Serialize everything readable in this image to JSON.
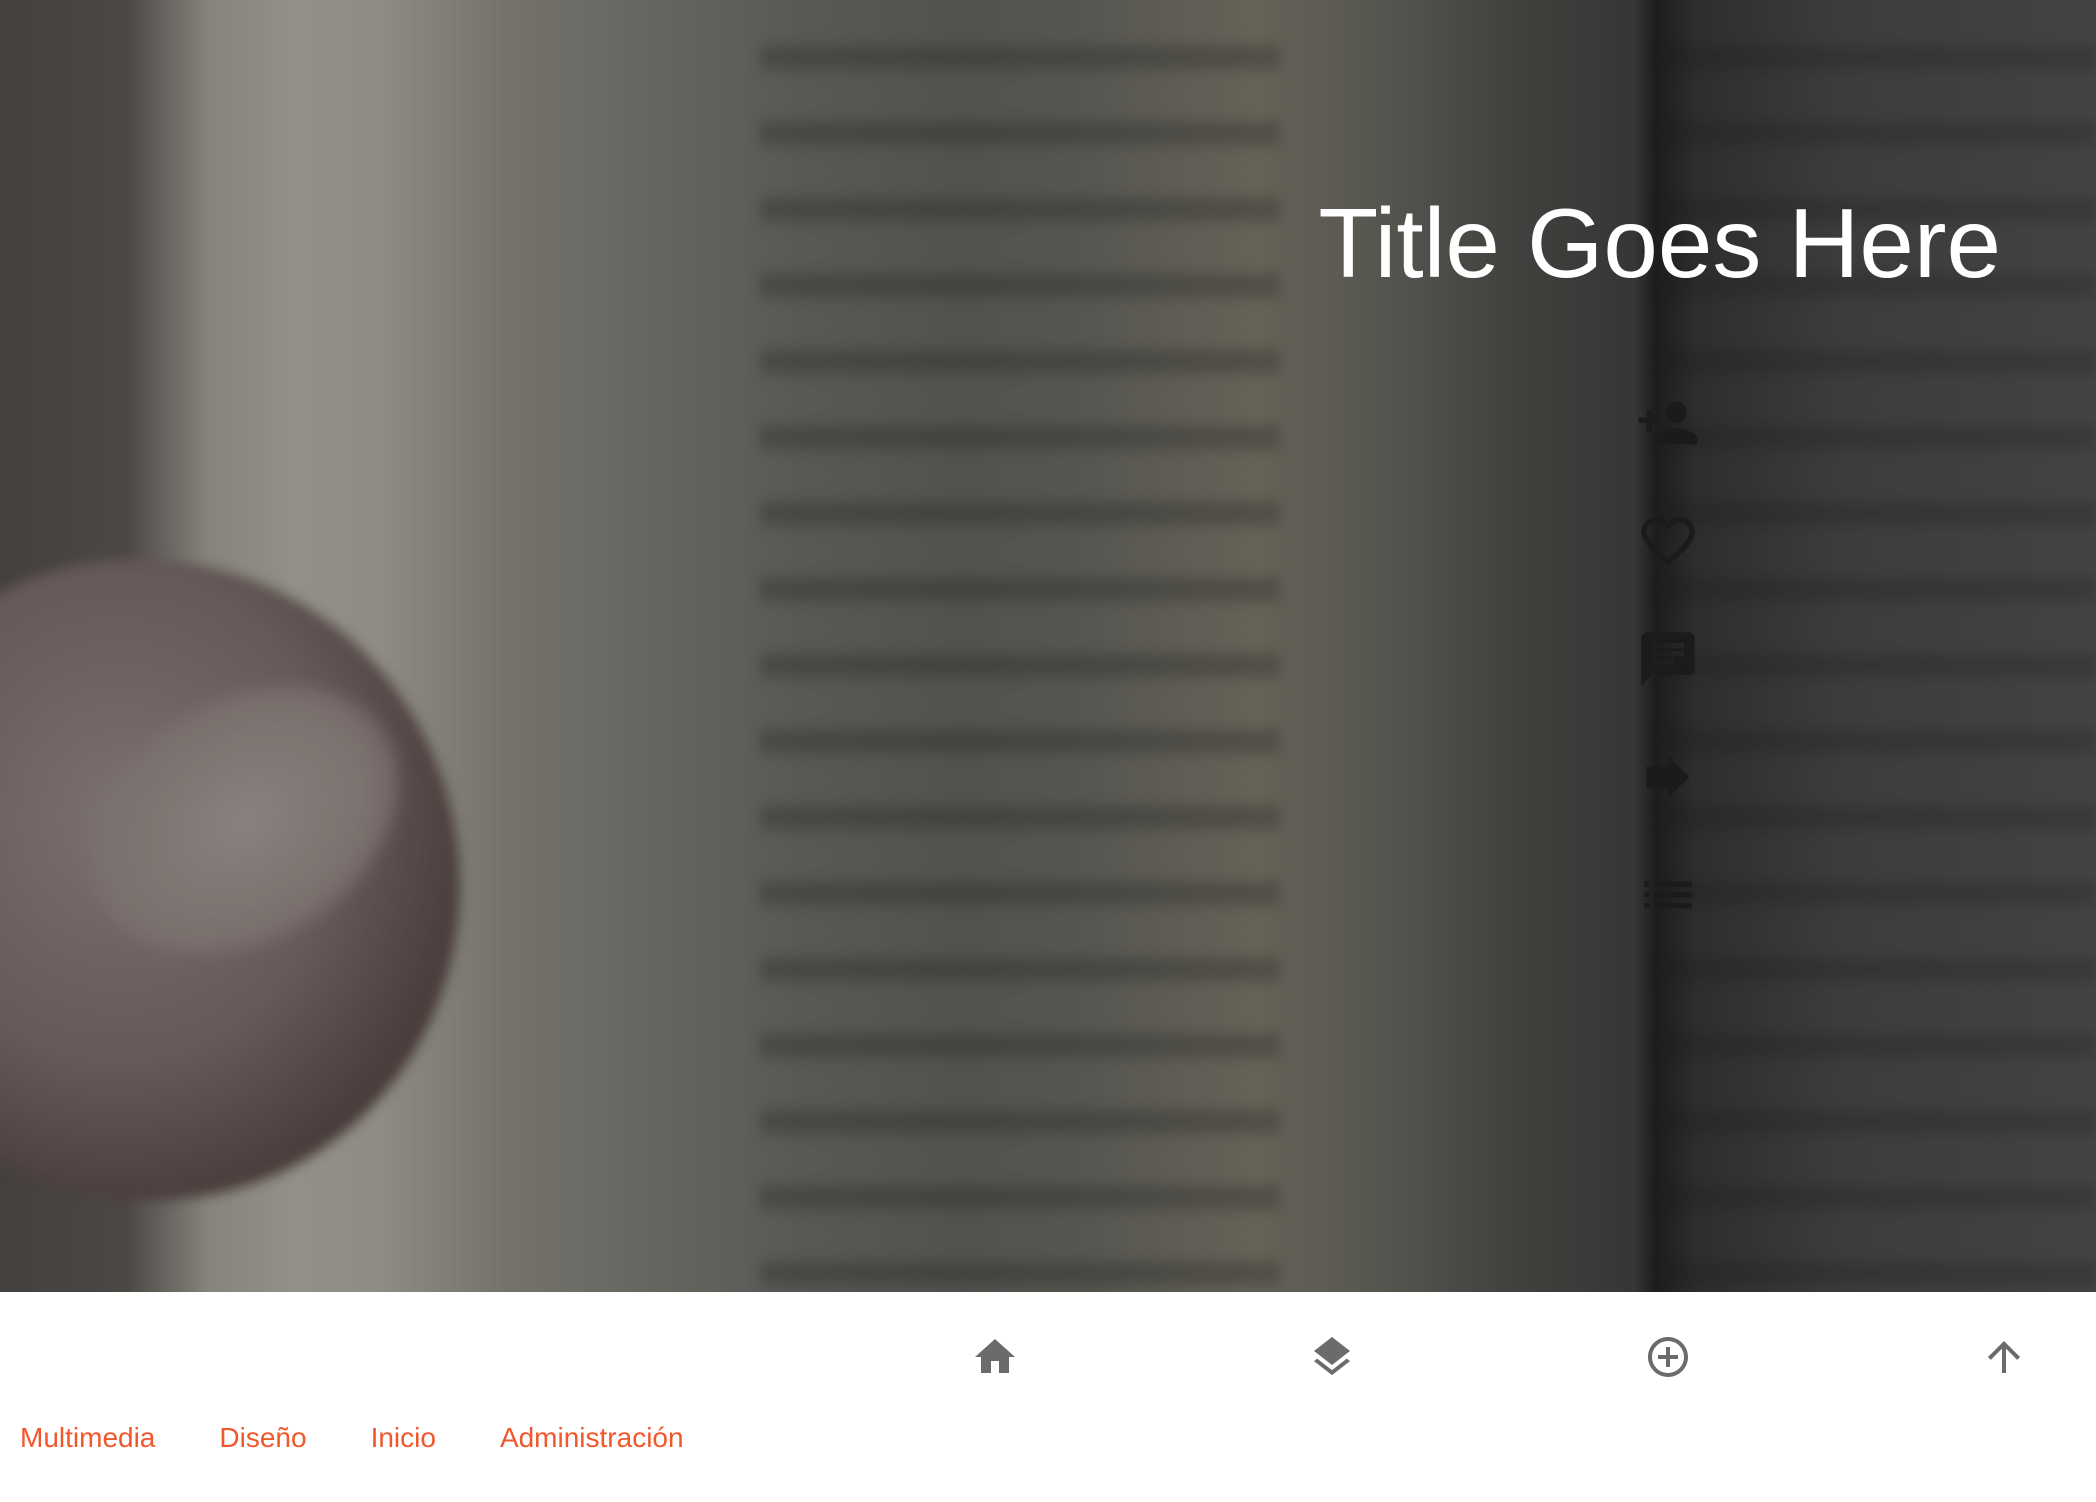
{
  "hero": {
    "title": "Title Goes Here",
    "overlay_color": "#000000",
    "title_color": "#ffffff"
  },
  "actions": [
    {
      "icon": "person-add-icon"
    },
    {
      "icon": "heart-outline-icon"
    },
    {
      "icon": "comment-icon"
    },
    {
      "icon": "arrow-forward-icon"
    },
    {
      "icon": "list-icon"
    }
  ],
  "nav": [
    {
      "icon": "home-icon"
    },
    {
      "icon": "layers-icon"
    },
    {
      "icon": "add-circle-outline-icon"
    },
    {
      "icon": "arrow-upward-icon"
    }
  ],
  "footer": {
    "links": [
      "Multimedia",
      "Diseño",
      "Inicio",
      "Administración"
    ],
    "link_color": "#f2572b"
  }
}
